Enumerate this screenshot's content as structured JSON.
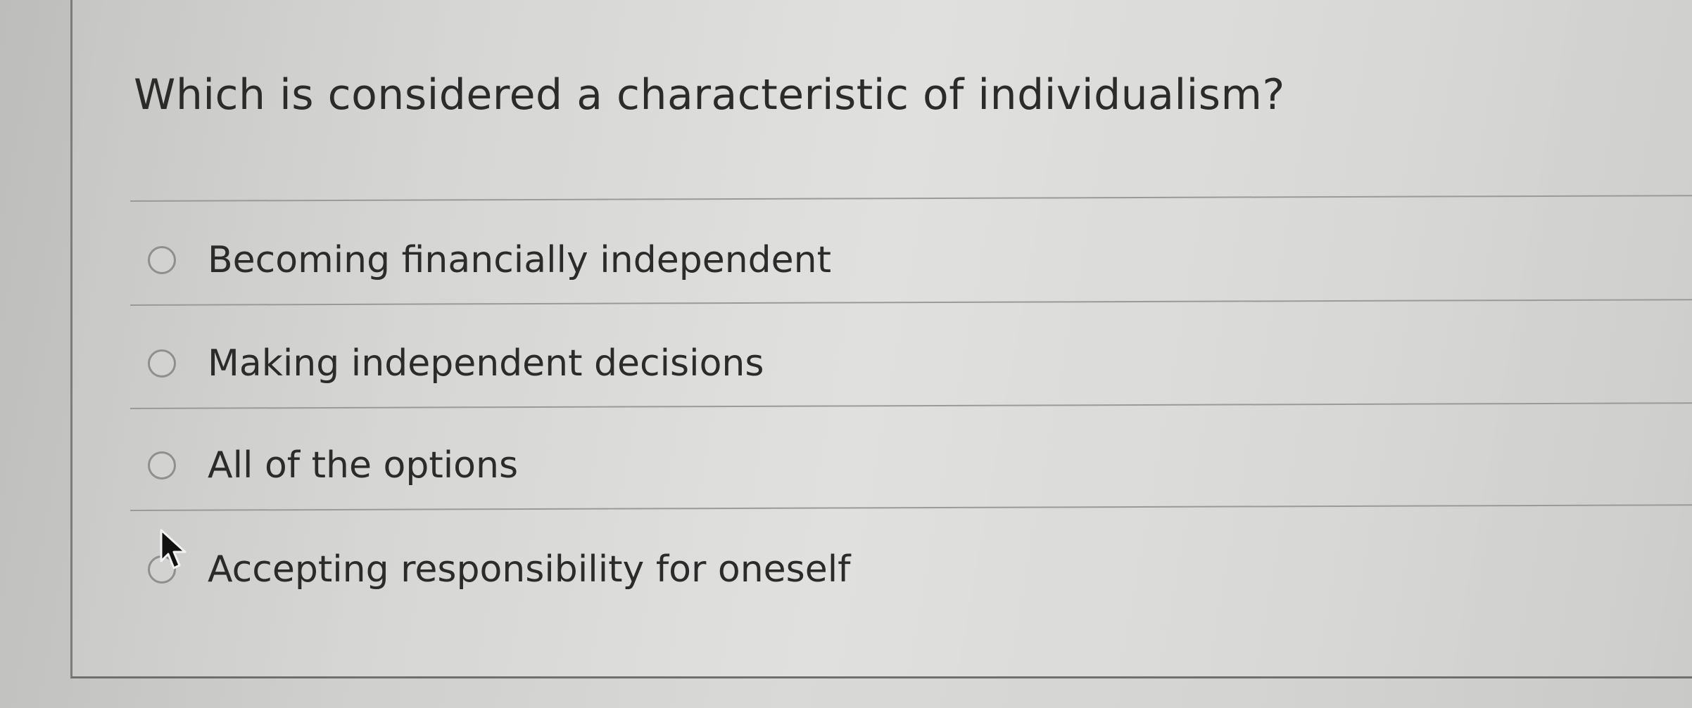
{
  "quiz": {
    "question": "Which is considered a characteristic of individualism?",
    "options": [
      {
        "label": "Becoming financially independent",
        "selected": false
      },
      {
        "label": "Making independent decisions",
        "selected": false
      },
      {
        "label": "All of the options",
        "selected": false
      },
      {
        "label": "Accepting responsibility for oneself",
        "selected": false
      }
    ]
  },
  "colors": {
    "text": "#2b2b2b",
    "radio_border": "#8f8f8d",
    "divider": "#9a9a98"
  }
}
